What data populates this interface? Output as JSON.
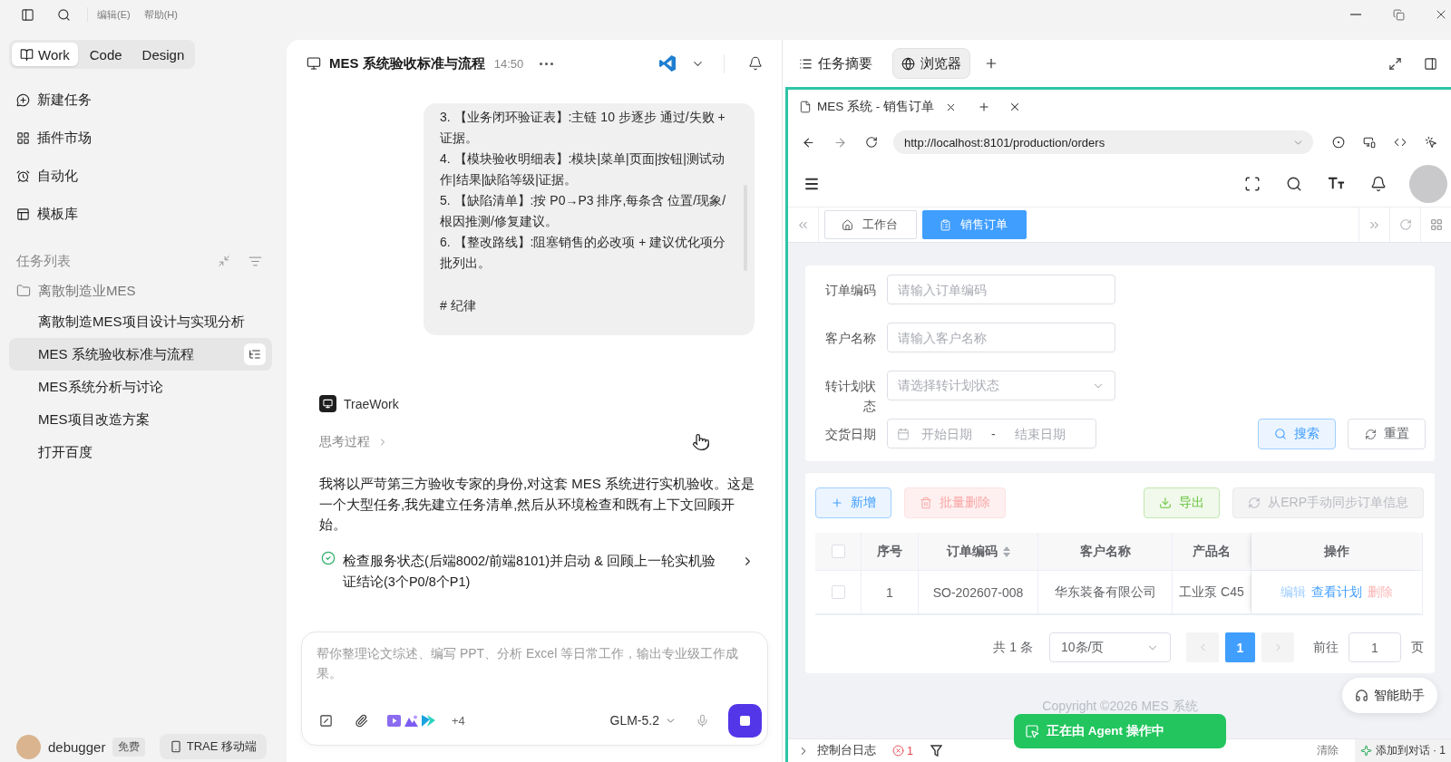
{
  "titlebar": {
    "menu": [
      "编辑(E)",
      "帮助(H)"
    ]
  },
  "sidebar": {
    "mode_tabs": [
      {
        "label": "Work",
        "selected": true
      },
      {
        "label": "Code",
        "selected": false
      },
      {
        "label": "Design",
        "selected": false
      }
    ],
    "nav": [
      {
        "kind": "new",
        "label": "新建任务"
      },
      {
        "kind": "plugins",
        "label": "插件市场"
      },
      {
        "kind": "automation",
        "label": "自动化"
      },
      {
        "kind": "templates",
        "label": "模板库"
      }
    ],
    "task_list": {
      "title": "任务列表",
      "folders": [
        {
          "label": "离散制造业MES",
          "children": [
            {
              "label": "离散制造MES项目设计与实现分析",
              "selected": false
            },
            {
              "label": "MES 系统验收标准与流程",
              "selected": true
            },
            {
              "label": "MES系统分析与讨论",
              "selected": false
            },
            {
              "label": "MES项目改造方案",
              "selected": false
            },
            {
              "label": "打开百度",
              "selected": false
            }
          ]
        }
      ]
    },
    "user": {
      "name": "debugger",
      "plan": "免费"
    },
    "mobile_button": "TRAE 移动端"
  },
  "chat": {
    "title": "MES 系统验收标准与流程",
    "time": "14:50",
    "user_message": [
      {
        "kind": "item",
        "text": "3. 【业务闭环验证表】:主链 10 步逐步 通过/失败 + 证据。"
      },
      {
        "kind": "item",
        "text": "4. 【模块验收明细表】:模块|菜单|页面|按钮|测试动作|结果|缺陷等级|证据。"
      },
      {
        "kind": "item",
        "text": "5. 【缺陷清单】:按 P0→P3 排序,每条含 位置/现象/根因推测/修复建议。"
      },
      {
        "kind": "item",
        "text": "6. 【整改路线】:阻塞销售的必改项 + 建议优化项分批列出。"
      },
      {
        "kind": "heading",
        "text": "# 纪律"
      }
    ],
    "assistant": {
      "name": "TraeWork",
      "thinking": "思考过程",
      "text": "我将以严苛第三方验收专家的身份,对这套 MES 系统进行实机验收。这是一个大型任务,我先建立任务清单,然后从环境检查和既有上下文回顾开始。",
      "steps": [
        {
          "text": "检查服务状态(后端8002/前端8101)并启动 & 回顾上一轮实机验证结论(3个P0/8个P1)",
          "done": true
        }
      ]
    },
    "composer": {
      "placeholder": "帮你整理论文综述、编写 PPT、分析 Excel 等日常工作，输出专业级工作成果。",
      "extra_apps": "+4",
      "model": "GLM-5.2"
    }
  },
  "side_panel": {
    "tabs": [
      {
        "kind": "summary",
        "label": "任务摘要",
        "selected": false
      },
      {
        "kind": "browser",
        "label": "浏览器",
        "selected": true
      }
    ],
    "browser": {
      "tab_title": "MES 系统 - 销售订单",
      "url": "http://localhost:8101/production/orders"
    }
  },
  "mes_page": {
    "page_tabs": [
      {
        "kind": "home",
        "label": "工作台",
        "selected": false
      },
      {
        "kind": "doc",
        "label": "销售订单",
        "selected": true
      }
    ],
    "filters": [
      {
        "kind": "text",
        "label": "订单编码",
        "placeholder": "请输入订单编码"
      },
      {
        "kind": "text",
        "label": "客户名称",
        "placeholder": "请输入客户名称"
      },
      {
        "kind": "select",
        "label": "转计划状态",
        "placeholder": "请选择转计划状态"
      },
      {
        "kind": "daterange",
        "label": "交货日期",
        "start_placeholder": "开始日期",
        "separator": "-",
        "end_placeholder": "结束日期"
      }
    ],
    "search_button": "搜索",
    "reset_button": "重置",
    "actions": [
      {
        "kind": "primary",
        "label": "新增",
        "disabled": false
      },
      {
        "kind": "danger",
        "label": "批量删除",
        "disabled": true
      },
      {
        "kind": "success",
        "label": "导出",
        "disabled": false
      },
      {
        "kind": "info",
        "label": "从ERP手动同步订单信息",
        "disabled": true
      }
    ],
    "table": {
      "header_checked": false,
      "columns": [
        {
          "kind": "plain",
          "label": "序号"
        },
        {
          "kind": "sortable",
          "label": "订单编码"
        },
        {
          "kind": "plain",
          "label": "客户名称"
        },
        {
          "kind": "plain",
          "label": "产品名"
        },
        {
          "kind": "plain",
          "label": "操作"
        }
      ],
      "rows": [
        {
          "checked": false,
          "cells": [
            "1",
            "SO-202607-008",
            "华东装备有限公司",
            "工业泵 C45"
          ],
          "actions": [
            {
              "kind": "edit",
              "label": "编辑",
              "disabled": true
            },
            {
              "kind": "view",
              "label": "查看计划",
              "disabled": false
            },
            {
              "kind": "delete",
              "label": "删除",
              "disabled": true
            }
          ]
        }
      ]
    },
    "pagination": {
      "total": "共 1 条",
      "page_size": "10条/页",
      "pages": [
        {
          "label": "1",
          "selected": true
        }
      ],
      "goto_label": "前往",
      "goto_value": "1",
      "goto_suffix": "页"
    },
    "copyright": "Copyright ©2026 MES 系统",
    "assistant_button": "智能助手"
  },
  "agent_status": "正在由 Agent 操作中",
  "console": {
    "title": "控制台日志",
    "error_count": "1",
    "clear": "清除",
    "add_to_chat": "添加到对话 · 1"
  }
}
